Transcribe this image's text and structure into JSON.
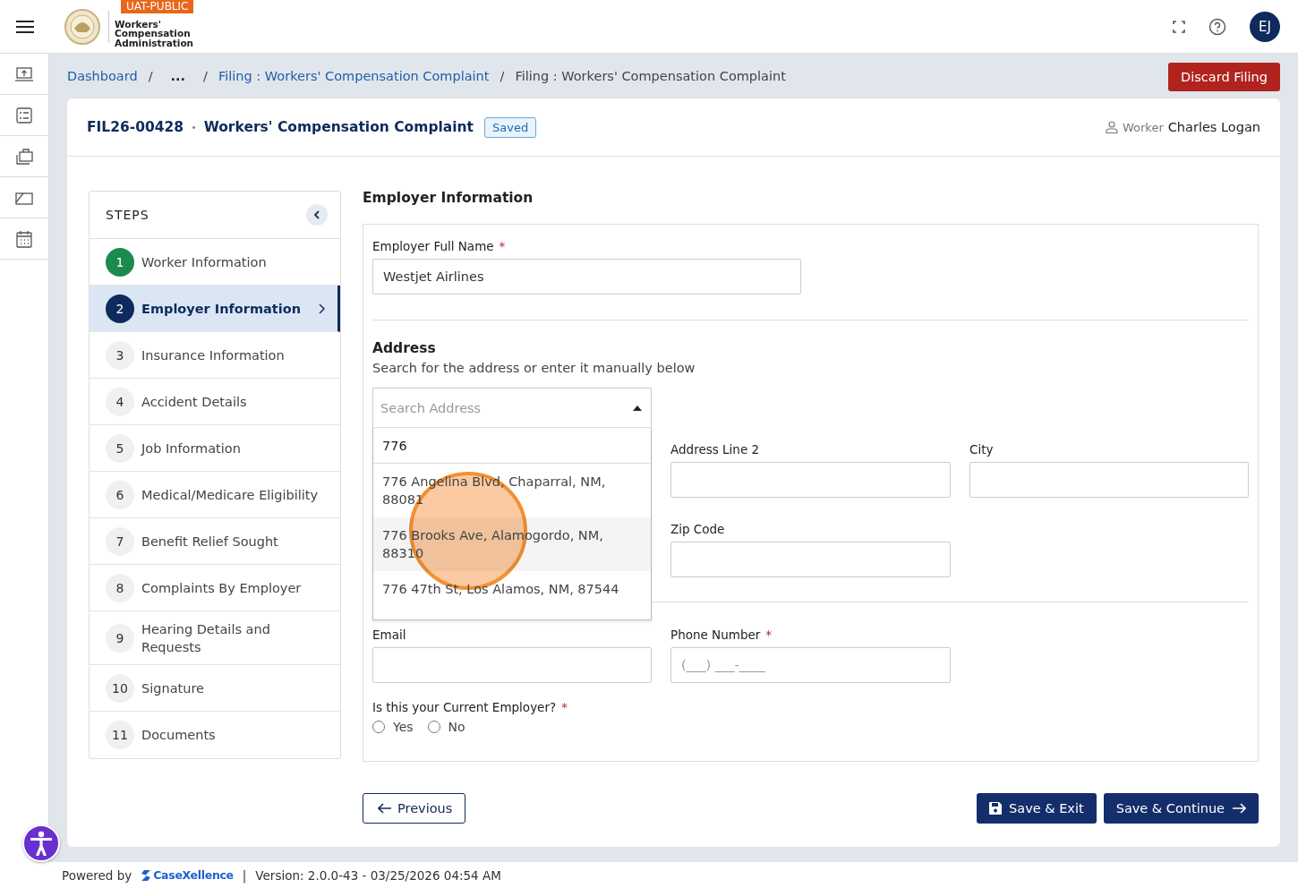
{
  "header": {
    "environment_badge": "UAT-PUBLIC",
    "logo": {
      "name_lines": [
        "Workers'",
        "Compensation",
        "Administration"
      ]
    },
    "avatar": "EJ"
  },
  "breadcrumb_separator": "/",
  "required_mark": "*",
  "breadcrumbs": [
    {
      "label": "Dashboard",
      "kind": "link"
    },
    {
      "label": "...",
      "kind": "text"
    },
    {
      "label": "Filing : Workers' Compensation Complaint",
      "kind": "link"
    },
    {
      "label": "Filing : Workers' Compensation Complaint",
      "kind": "current"
    }
  ],
  "discard_button": "Discard Filing",
  "filing": {
    "number": "FIL26-00428",
    "separator": "•",
    "title": "Workers' Compensation Complaint",
    "status": "Saved",
    "worker_label": "Worker",
    "worker_name": "Charles Logan"
  },
  "steps": {
    "title": "STEPS",
    "items": [
      {
        "number": "1",
        "label": "Worker Information",
        "selected": false,
        "completed": true
      },
      {
        "number": "2",
        "label": "Employer Information",
        "selected": true,
        "completed": false
      },
      {
        "number": "3",
        "label": "Insurance Information",
        "selected": false,
        "completed": false
      },
      {
        "number": "4",
        "label": "Accident Details",
        "selected": false,
        "completed": false
      },
      {
        "number": "5",
        "label": "Job Information",
        "selected": false,
        "completed": false
      },
      {
        "number": "6",
        "label": "Medical/Medicare Eligibility",
        "selected": false,
        "completed": false
      },
      {
        "number": "7",
        "label": "Benefit Relief Sought",
        "selected": false,
        "completed": false
      },
      {
        "number": "8",
        "label": "Complaints By Employer",
        "selected": false,
        "completed": false
      },
      {
        "number": "9",
        "label": "Hearing Details and Requests",
        "selected": false,
        "completed": false
      },
      {
        "number": "10",
        "label": "Signature",
        "selected": false,
        "completed": false
      },
      {
        "number": "11",
        "label": "Documents",
        "selected": false,
        "completed": false
      }
    ]
  },
  "form": {
    "title": "Employer Information",
    "employer_name": {
      "label": "Employer Full Name",
      "required": true,
      "value": "Westjet Airlines"
    },
    "address": {
      "title": "Address",
      "hint": "Search for the address or enter it manually below",
      "search": {
        "placeholder": "Search Address",
        "query": "776",
        "expanded": true,
        "options": [
          {
            "label": "776 Angelina Blvd, Chaparral, NM, 88081",
            "selected": false
          },
          {
            "label": "776 Brooks Ave, Alamogordo, NM, 88310",
            "selected": true
          },
          {
            "label": "776 47th St, Los Alamos, NM, 87544",
            "selected": false
          }
        ]
      },
      "fields": [
        {
          "label": "Address Line 2",
          "required": false
        },
        {
          "label": "City",
          "required": false
        },
        {
          "label": "Zip Code",
          "required": false
        }
      ]
    },
    "contact": [
      {
        "label": "Email",
        "required": false
      },
      {
        "label": "Phone Number",
        "required": true,
        "placeholder": "(___) ___-____"
      }
    ],
    "question": {
      "label": "Is this your Current Employer?",
      "required": true,
      "options": [
        {
          "label": "Yes",
          "checked": false
        },
        {
          "label": "No",
          "checked": false
        }
      ]
    }
  },
  "actions": {
    "previous": "Previous",
    "save_exit": "Save & Exit",
    "save_continue": "Save & Continue"
  },
  "footer": {
    "powered_by": "Powered by",
    "brand": "CaseXellence",
    "separator": "|",
    "version": "Version: 2.0.0-43 - 03/25/2026 04:54 AM"
  }
}
